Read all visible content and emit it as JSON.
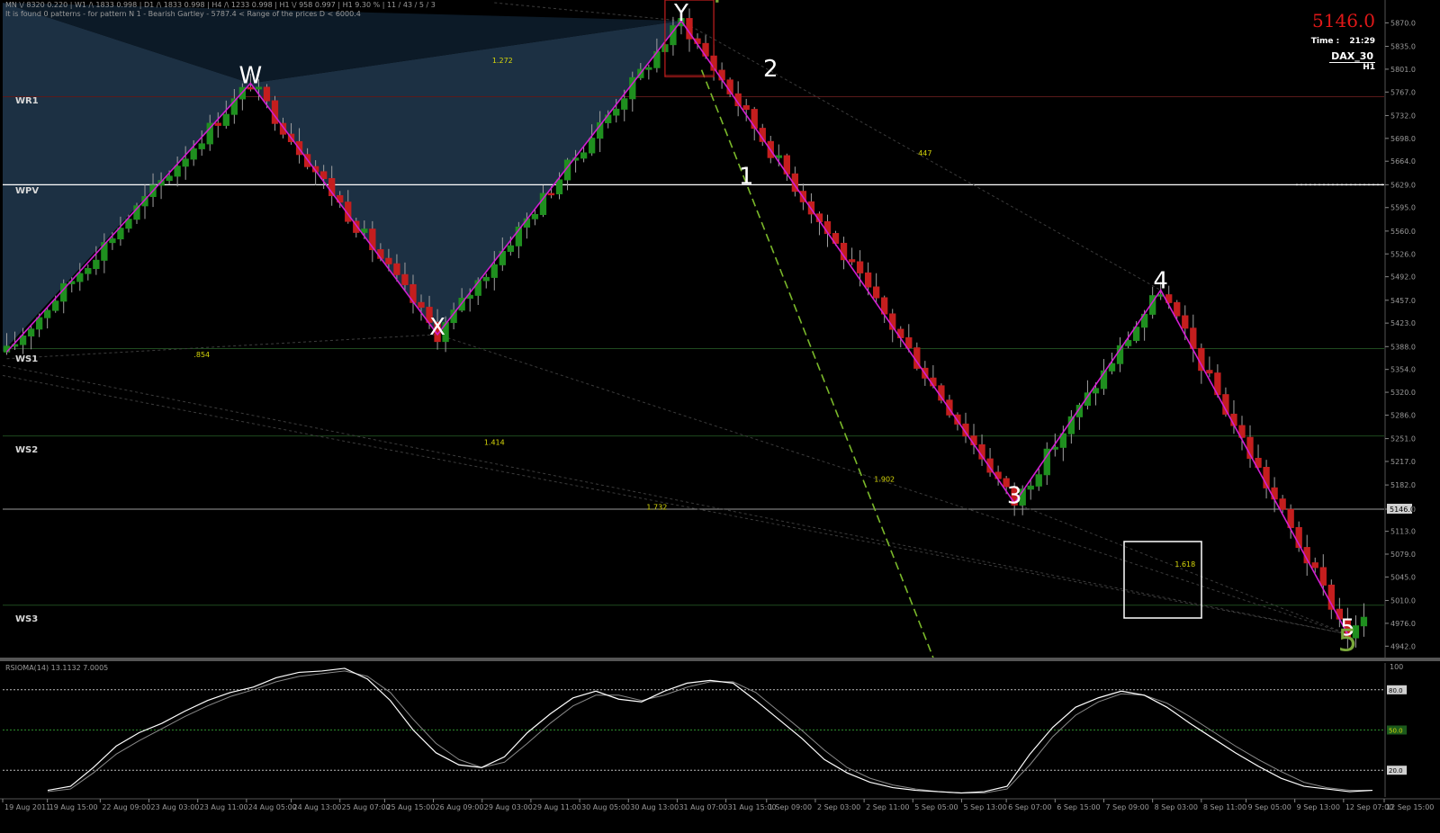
{
  "header": {
    "line1": "MN \\/ 8320  0.220 | W1 /\\ 1833  0.998 | D1 /\\ 1833  0.998 | H4 /\\ 1233  0.998 | H1 \\/ 958  0.997 | H1  9.30 %  | 11 / 43 / 5 / 3",
    "line2": "It is found 0 patterns  -  for pattern N 1 - Bearish Gartley - 5787.4 < Range of the prices D < 6000.4"
  },
  "price_panel": {
    "current_price": "5146.0",
    "time_label": "Time :",
    "time_value": "21:29",
    "symbol": "DAX_30",
    "timeframe": "H1"
  },
  "pivots": [
    {
      "label": "WR1",
      "value": 5760
    },
    {
      "label": "WPV",
      "value": 5629
    },
    {
      "label": "WS1",
      "value": 5385
    },
    {
      "label": "WS2",
      "value": 5255
    },
    {
      "label": "WS3",
      "value": 5003
    }
  ],
  "wave_labels": [
    {
      "text": "W",
      "x": 30,
      "y": 5780,
      "color": "#ffffff"
    },
    {
      "text": "X",
      "x": 53,
      "y": 5406,
      "color": "#ffffff"
    },
    {
      "text": "Y",
      "x": 83,
      "y": 5873,
      "color": "#ffffff"
    },
    {
      "text": "1",
      "x": 91,
      "y": 5630,
      "color": "#ffffff"
    },
    {
      "text": "2",
      "x": 94,
      "y": 5790,
      "color": "#ffffff"
    },
    {
      "text": "3",
      "x": 124,
      "y": 5155,
      "color": "#ffffff"
    },
    {
      "text": "4",
      "x": 142,
      "y": 5475,
      "color": "#ffffff"
    },
    {
      "text": "5",
      "x": 165,
      "y": 4958,
      "color": "#ffffff"
    },
    {
      "text": "4",
      "x": 87,
      "y": 5900,
      "color": "#7aa83a"
    },
    {
      "text": "5",
      "x": 165,
      "y": 4935,
      "color": "#7aa83a"
    }
  ],
  "fib_labels": [
    {
      "text": "1.272",
      "x": 61,
      "y": 5810
    },
    {
      "text": ".854",
      "x": 24,
      "y": 5372
    },
    {
      "text": "1.414",
      "x": 60,
      "y": 5242
    },
    {
      "text": "1.902",
      "x": 108,
      "y": 5187
    },
    {
      "text": "1.732",
      "x": 80,
      "y": 5145
    },
    {
      "text": "447",
      "x": 113,
      "y": 5672
    },
    {
      "text": "1.618",
      "x": 145,
      "y": 5060
    }
  ],
  "rsi": {
    "title": "RSIOMA(14) 13.1132 7.0005",
    "levels": [
      80,
      50,
      20
    ],
    "level_labels": [
      "80.0",
      "50.0",
      "20.0"
    ],
    "ylim": [
      0,
      100
    ],
    "tick": "100",
    "main": [
      5,
      8,
      22,
      38,
      48,
      55,
      64,
      72,
      78,
      82,
      89,
      93,
      94,
      96,
      88,
      72,
      50,
      33,
      24,
      22,
      30,
      48,
      62,
      74,
      79,
      73,
      71,
      79,
      85,
      87,
      85,
      72,
      58,
      44,
      28,
      18,
      11,
      7,
      5,
      4,
      3,
      4,
      8,
      32,
      52,
      67,
      74,
      79,
      76,
      67,
      55,
      44,
      33,
      23,
      14,
      8,
      6,
      4,
      5
    ],
    "signal": [
      4,
      6,
      18,
      32,
      42,
      51,
      60,
      68,
      75,
      80,
      86,
      90,
      92,
      94,
      90,
      78,
      58,
      40,
      28,
      22,
      26,
      40,
      55,
      68,
      76,
      76,
      72,
      76,
      82,
      86,
      86,
      78,
      64,
      50,
      35,
      22,
      14,
      9,
      6,
      4,
      3,
      3,
      6,
      24,
      45,
      61,
      71,
      77,
      76,
      70,
      60,
      49,
      38,
      28,
      19,
      11,
      7,
      5,
      5
    ]
  },
  "chart_data": {
    "type": "candlestick",
    "title": "",
    "symbol": "DAX_30",
    "timeframe": "H1",
    "ylim": [
      4925,
      5900
    ],
    "yticks": [
      5870.0,
      5835.0,
      5801.0,
      5767.0,
      5732.0,
      5698.0,
      5664.0,
      5629.0,
      5595.0,
      5560.0,
      5526.0,
      5492.0,
      5457.0,
      5423.0,
      5388.0,
      5354.0,
      5320.0,
      5286.0,
      5251.0,
      5217.0,
      5182.0,
      5146.0,
      5113.0,
      5079.0,
      5045.0,
      5010.0,
      4976.0,
      4942.0
    ],
    "xticks": [
      {
        "i": 0,
        "label": "19 Aug 2011"
      },
      {
        "i": 5.5,
        "label": "19 Aug 15:00"
      },
      {
        "i": 12,
        "label": "22 Aug 09:00"
      },
      {
        "i": 18,
        "label": "23 Aug 03:00"
      },
      {
        "i": 24,
        "label": "23 Aug 11:00"
      },
      {
        "i": 30,
        "label": "24 Aug 05:00"
      },
      {
        "i": 35.5,
        "label": "24 Aug 13:00"
      },
      {
        "i": 41.5,
        "label": "25 Aug 07:00"
      },
      {
        "i": 47,
        "label": "25 Aug 15:00"
      },
      {
        "i": 53,
        "label": "26 Aug 09:00"
      },
      {
        "i": 59,
        "label": "29 Aug 03:00"
      },
      {
        "i": 65,
        "label": "29 Aug 11:00"
      },
      {
        "i": 71,
        "label": "30 Aug 05:00"
      },
      {
        "i": 77,
        "label": "30 Aug 13:00"
      },
      {
        "i": 83,
        "label": "31 Aug 07:00"
      },
      {
        "i": 89,
        "label": "31 Aug 15:00"
      },
      {
        "i": 94,
        "label": "1 Sep 09:00"
      },
      {
        "i": 100,
        "label": "2 Sep 03:00"
      },
      {
        "i": 106,
        "label": "2 Sep 11:00"
      },
      {
        "i": 112,
        "label": "5 Sep 05:00"
      },
      {
        "i": 118,
        "label": "5 Sep 13:00"
      },
      {
        "i": 123.5,
        "label": "6 Sep 07:00"
      },
      {
        "i": 129.5,
        "label": "6 Sep 15:00"
      },
      {
        "i": 135.5,
        "label": "7 Sep 09:00"
      },
      {
        "i": 141.5,
        "label": "8 Sep 03:00"
      },
      {
        "i": 147.5,
        "label": "8 Sep 11:00"
      },
      {
        "i": 153,
        "label": "9 Sep 05:00"
      },
      {
        "i": 159,
        "label": "9 Sep 13:00"
      },
      {
        "i": 165,
        "label": "12 Sep 07:00"
      },
      {
        "i": 170,
        "label": "12 Sep 15:00"
      }
    ],
    "closes": [
      5385,
      5405,
      5440,
      5430,
      5400,
      5420,
      5455,
      5480,
      5470,
      5445,
      5430,
      5460,
      5500,
      5520,
      5495,
      5480,
      5510,
      5545,
      5570,
      5555,
      5530,
      5555,
      5575,
      5585,
      5560,
      5590,
      5610,
      5600,
      5625,
      5660,
      5690,
      5705,
      5685,
      5700,
      5730,
      5760,
      5745,
      5720,
      5660,
      5580,
      5540,
      5500,
      5470,
      5440,
      5410,
      5430,
      5460,
      5520,
      5570,
      5610,
      5650,
      5640,
      5665,
      5675,
      5690,
      5700,
      5680,
      5660,
      5640,
      5655,
      5690,
      5700,
      5710,
      5730,
      5755,
      5790,
      5830,
      5855,
      5800,
      5765,
      5780,
      5745,
      5720,
      5690,
      5660,
      5650,
      5680,
      5650,
      5610,
      5570,
      5540,
      5510,
      5470,
      5420,
      5380,
      5350,
      5310,
      5260,
      5220,
      5200,
      5180,
      5160,
      5210,
      5240,
      5260,
      5290,
      5330,
      5360,
      5380,
      5400,
      5420,
      5440,
      5455,
      5470,
      5430,
      5400,
      5380,
      5360,
      5350,
      5340,
      5320,
      5280,
      5230,
      5180,
      5120,
      5050,
      5000,
      4970,
      4990,
      5050,
      5080,
      5110,
      5146
    ],
    "moves": [
      {
        "from": 0,
        "to": 33,
        "label": "W"
      },
      {
        "from": 33,
        "to": 44,
        "label": "X"
      },
      {
        "from": 44,
        "to": 67,
        "label": "Y"
      },
      {
        "from": 67,
        "to": 89,
        "label": "1-3"
      },
      {
        "from": 89,
        "to": 101,
        "label": "4"
      },
      {
        "from": 101,
        "to": 117,
        "label": "5"
      }
    ],
    "zigzag": [
      {
        "x": 0,
        "y": 5380
      },
      {
        "x": 30,
        "y": 5780
      },
      {
        "x": 53,
        "y": 5406
      },
      {
        "x": 83,
        "y": 5873
      },
      {
        "x": 124,
        "y": 5155
      },
      {
        "x": 142,
        "y": 5472
      },
      {
        "x": 165,
        "y": 4960
      }
    ]
  }
}
